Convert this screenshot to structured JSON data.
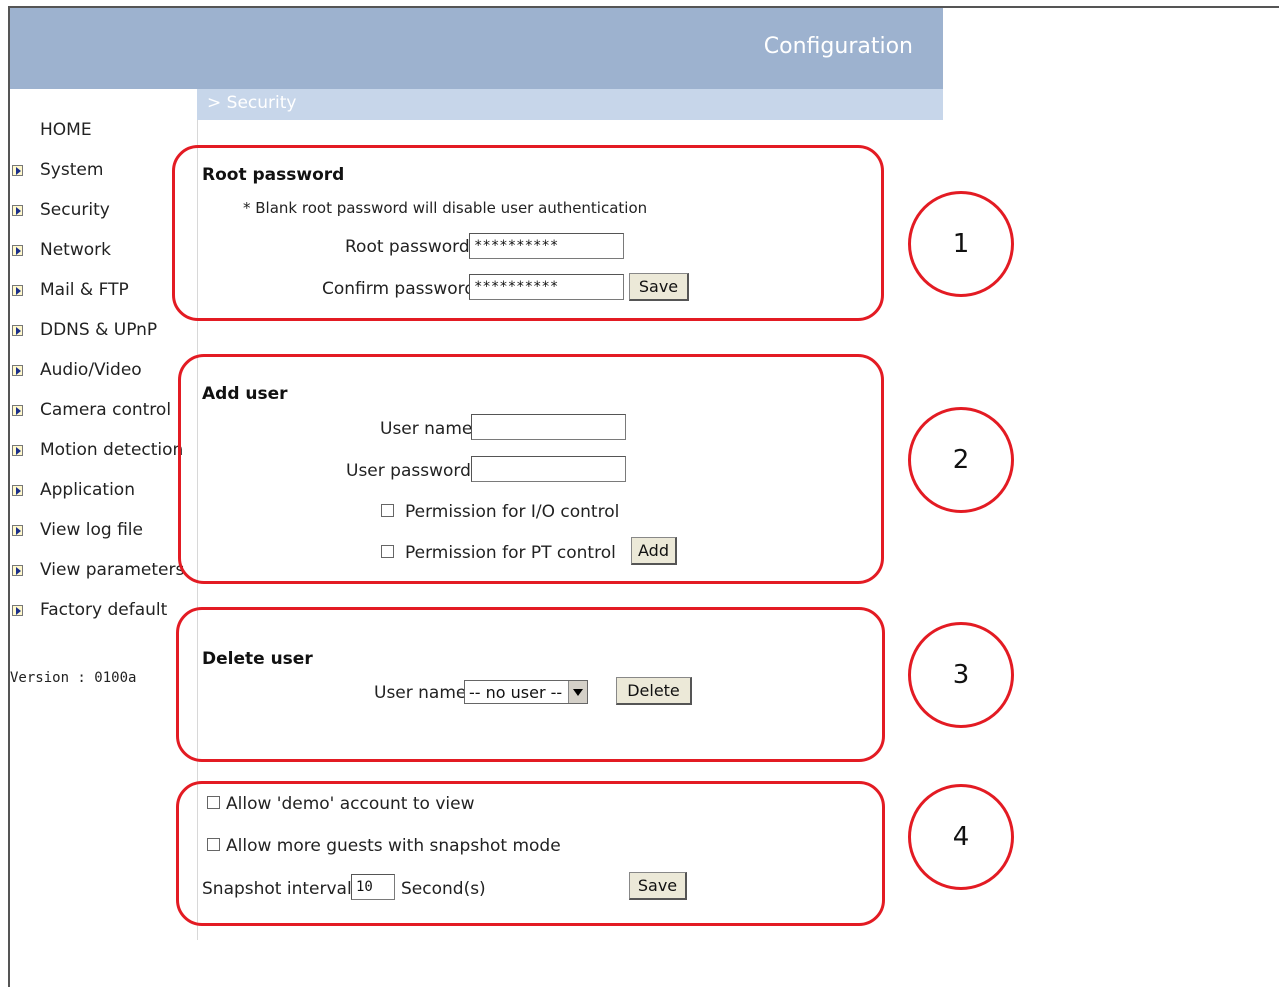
{
  "header": {
    "title": "Configuration"
  },
  "breadcrumb": "> Security",
  "sidebar": {
    "home": "HOME",
    "items": [
      {
        "label": "System"
      },
      {
        "label": "Security"
      },
      {
        "label": "Network"
      },
      {
        "label": "Mail & FTP"
      },
      {
        "label": "DDNS & UPnP"
      },
      {
        "label": "Audio/Video"
      },
      {
        "label": "Camera control"
      },
      {
        "label": "Motion detection"
      },
      {
        "label": "Application"
      },
      {
        "label": "View log file"
      },
      {
        "label": "View parameters"
      },
      {
        "label": "Factory default"
      }
    ],
    "version": "Version : 0100a"
  },
  "root_password": {
    "title": "Root password",
    "note": "* Blank root password will disable user authentication",
    "root_label": "Root password",
    "root_value": "**********",
    "confirm_label": "Confirm password",
    "confirm_value": "**********",
    "save_label": "Save"
  },
  "add_user": {
    "title": "Add user",
    "name_label": "User name",
    "name_value": "",
    "password_label": "User password",
    "password_value": "",
    "io_label": "Permission for I/O control",
    "pt_label": "Permission for PT control",
    "add_label": "Add"
  },
  "delete_user": {
    "title": "Delete user",
    "name_label": "User name",
    "selected": "-- no user --",
    "delete_label": "Delete"
  },
  "guest": {
    "demo_label": "Allow 'demo' account to view",
    "snapshot_label": "Allow more guests with snapshot mode",
    "interval_label": "Snapshot interval:",
    "interval_value": "10",
    "interval_unit": "Second(s)",
    "save_label": "Save"
  },
  "callouts": [
    "1",
    "2",
    "3",
    "4"
  ],
  "colors": {
    "header": "#9db2cf",
    "subbar": "#c7d6ea",
    "callout": "#e31b23"
  }
}
